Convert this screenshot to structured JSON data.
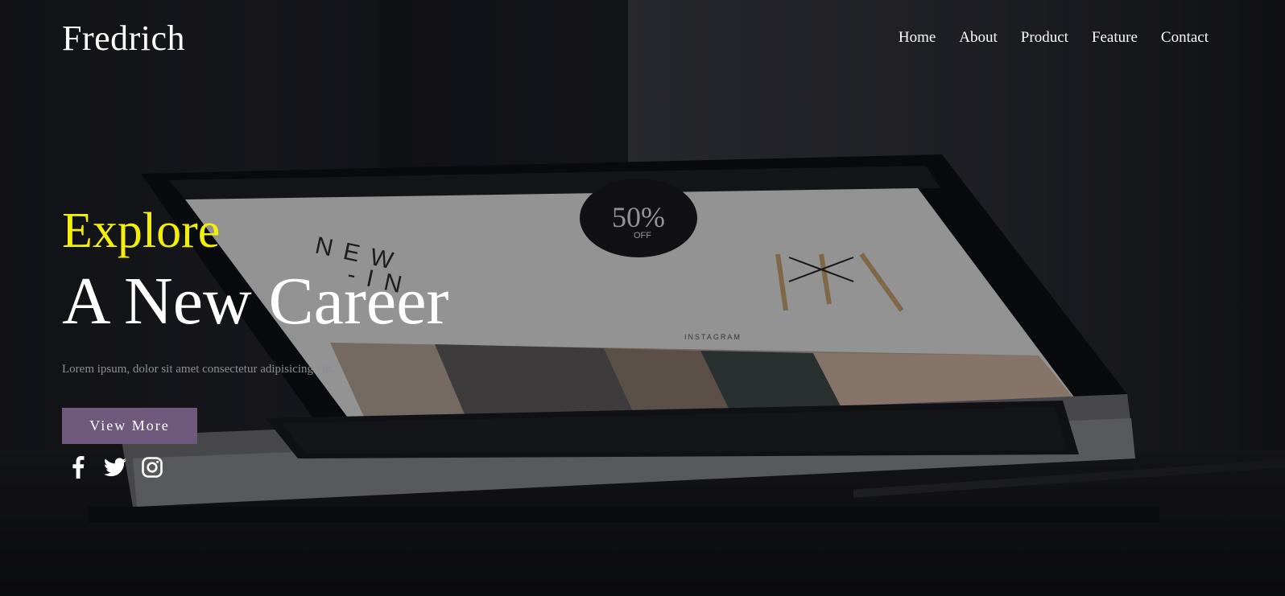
{
  "brand": {
    "name": "Fredrich"
  },
  "nav": {
    "items": [
      {
        "label": "Home"
      },
      {
        "label": "About"
      },
      {
        "label": "Product"
      },
      {
        "label": "Feature"
      },
      {
        "label": "Contact"
      }
    ]
  },
  "hero": {
    "kicker": "Explore",
    "headline": "A New Career",
    "subtext": "Lorem ipsum, dolor sit amet consectetur adipisicing elit.",
    "cta_label": "View More"
  },
  "background_screen": {
    "promo": "NEW -IN",
    "badge_value": "50%",
    "badge_label": "OFF",
    "section_label": "INSTAGRAM"
  },
  "socials": [
    {
      "icon": "facebook-icon"
    },
    {
      "icon": "twitter-icon"
    },
    {
      "icon": "instagram-icon"
    }
  ],
  "colors": {
    "accent_yellow": "#f2ef0a",
    "button_purple": "#6f5a7e",
    "text_white": "#ffffff",
    "subtext_gray": "#8d8e93"
  }
}
